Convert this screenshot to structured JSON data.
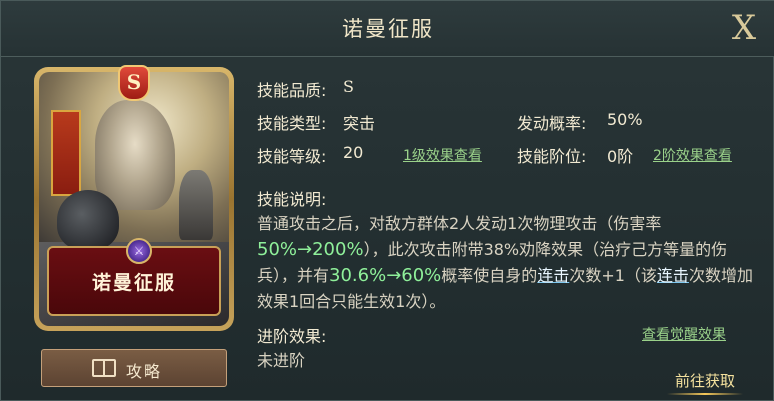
{
  "header": {
    "title": "诺曼征服",
    "close_label": "X"
  },
  "card": {
    "grade_badge": "S",
    "name": "诺曼征服",
    "gem_glyph": "⚔"
  },
  "guide_button": {
    "label": "攻略",
    "icon": "book-icon"
  },
  "info": {
    "quality_label": "技能品质:",
    "quality_value": "S",
    "type_label": "技能类型:",
    "type_value": "突击",
    "chance_label": "发动概率:",
    "chance_value": "50%",
    "level_label": "技能等级:",
    "level_value": "20",
    "level_link": "1级效果查看",
    "stage_label": "技能阶位:",
    "stage_value": "0阶",
    "stage_link": "2阶效果查看"
  },
  "description": {
    "label": "技能说明:",
    "part1": "普通攻击之后，对敌方群体2人发动1次物理攻击（伤害率",
    "hl1": "50%→200%",
    "part2": "），此次攻击附带38%劝降效果（治疗己方等量的伤兵），并有",
    "hl2": "30.6%→60%",
    "part3": "概率使自身的",
    "kw1": "连击",
    "part4": "次数+1（该",
    "kw2": "连击",
    "part5": "次数增加效果1回合只能生效1次）。"
  },
  "advance": {
    "label": "进阶效果:",
    "value": "未进阶",
    "link": "查看觉醒效果"
  },
  "acquire": {
    "label": "前往获取"
  },
  "colors": {
    "accent_gold": "#d8b66a",
    "highlight_green": "#8ff09a",
    "link_green": "#9ad28a"
  }
}
